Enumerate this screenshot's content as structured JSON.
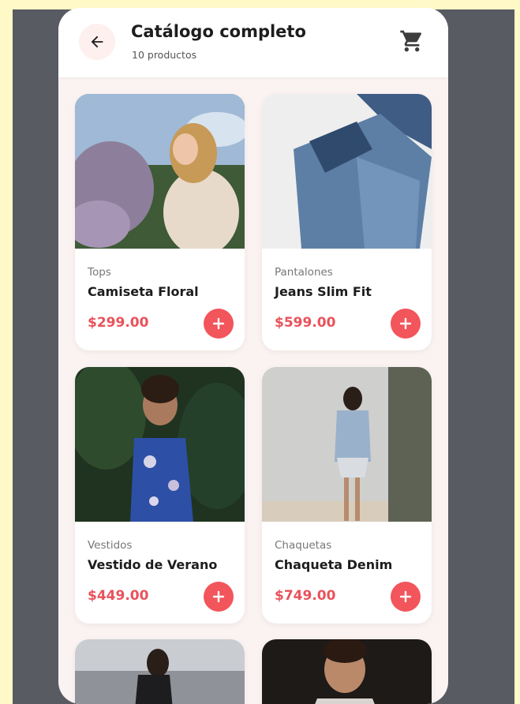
{
  "header": {
    "title": "Catálogo completo",
    "subtitle": "10 productos",
    "back_icon": "arrow-left-icon",
    "cart_icon": "cart-icon"
  },
  "colors": {
    "accent": "#f2555b",
    "price": "#e9525b",
    "background": "#fbf3f2"
  },
  "products": [
    {
      "category": "Tops",
      "name": "Camiseta Floral",
      "price": "$299.00"
    },
    {
      "category": "Pantalones",
      "name": "Jeans Slim Fit",
      "price": "$599.00"
    },
    {
      "category": "Vestidos",
      "name": "Vestido de Verano",
      "price": "$449.00"
    },
    {
      "category": "Chaquetas",
      "name": "Chaqueta Denim",
      "price": "$749.00"
    }
  ]
}
